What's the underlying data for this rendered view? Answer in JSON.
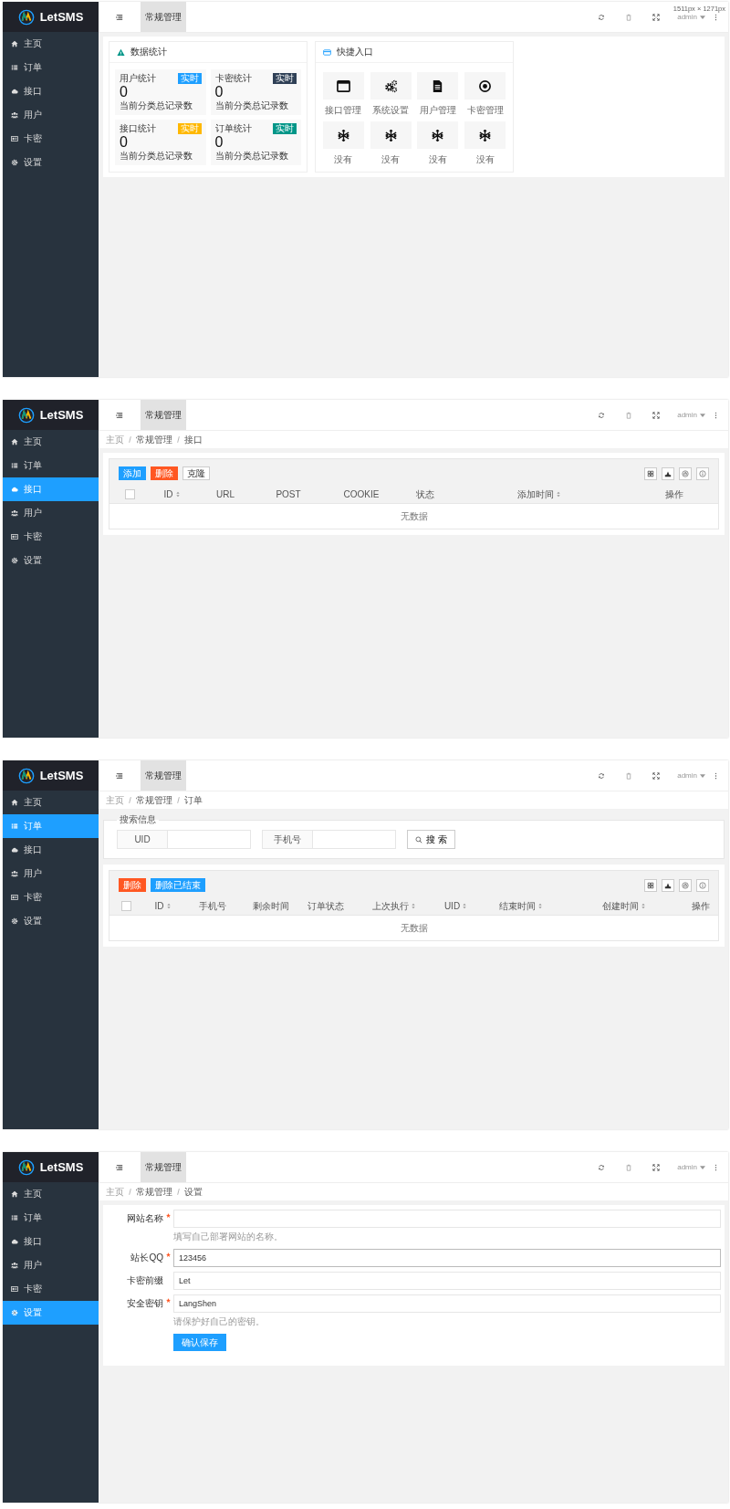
{
  "screens": [
    {
      "kind": "dashboard",
      "logo": "LetSMS",
      "header_tab": "常规管理",
      "user": "admin",
      "dimension_label": "1511px × 1271px",
      "nav": [
        {
          "label": "主页",
          "selected": false
        },
        {
          "label": "订单",
          "selected": false
        },
        {
          "label": "接口",
          "selected": false
        },
        {
          "label": "用户",
          "selected": false
        },
        {
          "label": "卡密",
          "selected": false
        },
        {
          "label": "设置",
          "selected": false
        }
      ],
      "stats_panel": {
        "title": "数据统计",
        "cards": [
          {
            "label": "用户统计",
            "badge": "实时",
            "color": "#1e9fff",
            "value": "0",
            "note": "当前分类总记录数"
          },
          {
            "label": "卡密统计",
            "badge": "实时",
            "color": "#2f4056",
            "value": "0",
            "note": "当前分类总记录数"
          },
          {
            "label": "接口统计",
            "badge": "实时",
            "color": "#ffb800",
            "value": "0",
            "note": "当前分类总记录数"
          },
          {
            "label": "订单统计",
            "badge": "实时",
            "color": "#009688",
            "value": "0",
            "note": "当前分类总记录数"
          }
        ]
      },
      "shortcuts_panel": {
        "title": "快捷入口",
        "items": [
          {
            "label": "接口管理"
          },
          {
            "label": "系统设置"
          },
          {
            "label": "用户管理"
          },
          {
            "label": "卡密管理"
          },
          {
            "label": "没有"
          },
          {
            "label": "没有"
          },
          {
            "label": "没有"
          },
          {
            "label": "没有"
          }
        ]
      }
    },
    {
      "kind": "table",
      "logo": "LetSMS",
      "header_tab": "常规管理",
      "user": "admin",
      "nav": [
        {
          "label": "主页",
          "selected": false
        },
        {
          "label": "订单",
          "selected": false
        },
        {
          "label": "接口",
          "selected": true
        },
        {
          "label": "用户",
          "selected": false
        },
        {
          "label": "卡密",
          "selected": false
        },
        {
          "label": "设置",
          "selected": false
        }
      ],
      "breadcrumb": [
        "主页",
        "常规管理",
        "接口"
      ],
      "toolbar": [
        {
          "label": "添加",
          "kind": "primary"
        },
        {
          "label": "删除",
          "kind": "danger"
        },
        {
          "label": "克隆",
          "kind": "plain"
        }
      ],
      "select_all_checked": false,
      "columns": [
        {
          "label": "ID",
          "sortable": true
        },
        {
          "label": "URL",
          "sortable": false
        },
        {
          "label": "POST",
          "sortable": false
        },
        {
          "label": "COOKIE",
          "sortable": false
        },
        {
          "label": "状态",
          "sortable": false
        },
        {
          "label": "添加时间",
          "sortable": true
        },
        {
          "label": "操作",
          "sortable": false
        }
      ],
      "empty_text": "无数据"
    },
    {
      "kind": "search_table",
      "logo": "LetSMS",
      "header_tab": "常规管理",
      "user": "admin",
      "nav": [
        {
          "label": "主页",
          "selected": false
        },
        {
          "label": "订单",
          "selected": true
        },
        {
          "label": "接口",
          "selected": false
        },
        {
          "label": "用户",
          "selected": false
        },
        {
          "label": "卡密",
          "selected": false
        },
        {
          "label": "设置",
          "selected": false
        }
      ],
      "breadcrumb": [
        "主页",
        "常规管理",
        "订单"
      ],
      "search": {
        "legend": "搜索信息",
        "fields": [
          {
            "label": "UID"
          },
          {
            "label": "手机号"
          }
        ],
        "button": "搜 索"
      },
      "toolbar": [
        {
          "label": "删除",
          "kind": "danger"
        },
        {
          "label": "删除已结束",
          "kind": "primary"
        }
      ],
      "select_all_checked": false,
      "columns": [
        {
          "label": "ID",
          "sortable": true
        },
        {
          "label": "手机号",
          "sortable": false
        },
        {
          "label": "剩余时间",
          "sortable": false
        },
        {
          "label": "订单状态",
          "sortable": false
        },
        {
          "label": "上次执行",
          "sortable": true
        },
        {
          "label": "UID",
          "sortable": true
        },
        {
          "label": "结束时间",
          "sortable": true
        },
        {
          "label": "创建时间",
          "sortable": true
        },
        {
          "label": "操作",
          "sortable": false
        }
      ],
      "empty_text": "无数据"
    },
    {
      "kind": "form",
      "logo": "LetSMS",
      "header_tab": "常规管理",
      "user": "admin",
      "nav": [
        {
          "label": "主页",
          "selected": false
        },
        {
          "label": "订单",
          "selected": false
        },
        {
          "label": "接口",
          "selected": false
        },
        {
          "label": "用户",
          "selected": false
        },
        {
          "label": "卡密",
          "selected": false
        },
        {
          "label": "设置",
          "selected": true
        }
      ],
      "breadcrumb": [
        "主页",
        "常规管理",
        "设置"
      ],
      "fields": [
        {
          "label": "网站名称",
          "required": true,
          "focused": false,
          "hint": "填写自己部署网站的名称。"
        },
        {
          "label": "站长QQ",
          "required": true,
          "focused": true,
          "value": "123456"
        },
        {
          "label": "卡密前缀",
          "required": false,
          "focused": false,
          "value": "Let"
        },
        {
          "label": "安全密钥",
          "required": true,
          "focused": false,
          "value": "LangShen",
          "hint": "请保护好自己的密钥。"
        }
      ],
      "submit": "确认保存"
    }
  ]
}
